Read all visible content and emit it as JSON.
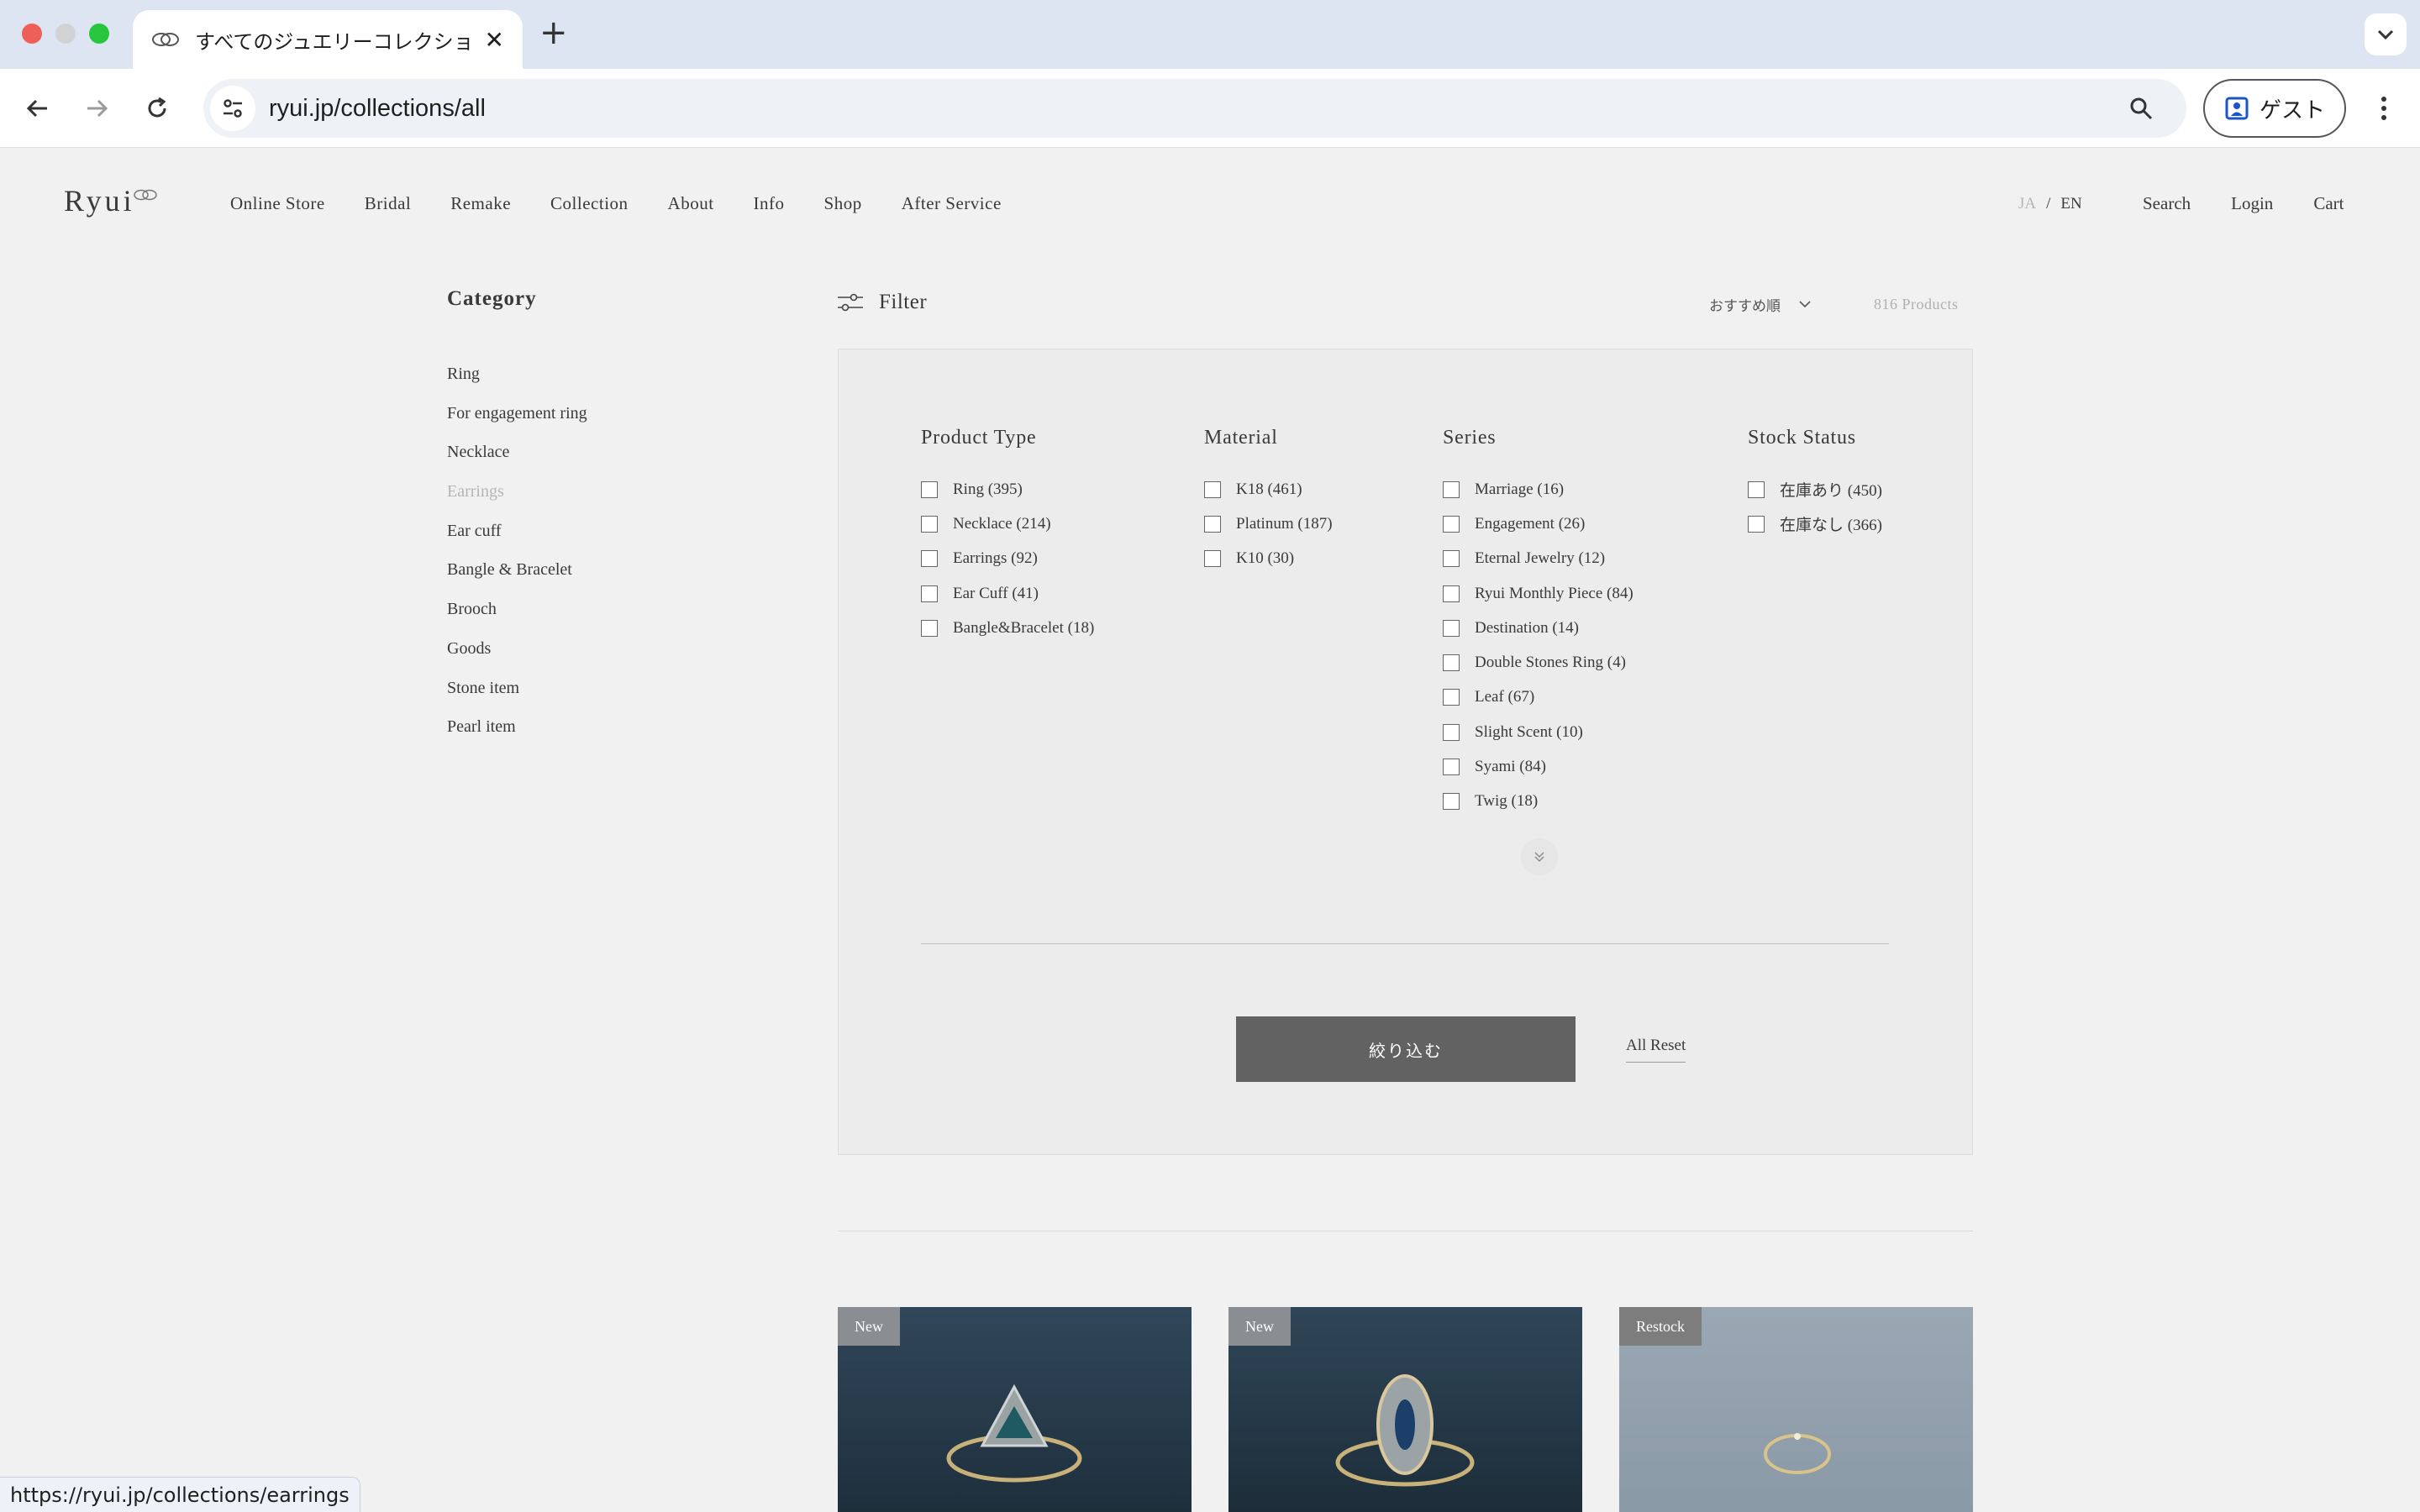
{
  "browser": {
    "tab_title": "すべてのジュエリーコレクション",
    "new_tab_label": "+",
    "tab_close_label": "✕",
    "url": "ryui.jp/collections/all",
    "profile_label": "ゲスト",
    "status_url": "https://ryui.jp/collections/earrings"
  },
  "site": {
    "logo": "Ryui",
    "nav": [
      "Online Store",
      "Bridal",
      "Remake",
      "Collection",
      "About",
      "Info",
      "Shop",
      "After Service"
    ],
    "lang": {
      "ja": "JA",
      "separator": "/",
      "en": "EN"
    },
    "util_nav": [
      "Search",
      "Login",
      "Cart"
    ]
  },
  "sidebar": {
    "title": "Category",
    "items": [
      {
        "label": "Ring"
      },
      {
        "label": "For engagement ring"
      },
      {
        "label": "Necklace"
      },
      {
        "label": "Earrings",
        "active": true
      },
      {
        "label": "Ear cuff"
      },
      {
        "label": "Bangle & Bracelet"
      },
      {
        "label": "Brooch"
      },
      {
        "label": "Goods"
      },
      {
        "label": "Stone item"
      },
      {
        "label": "Pearl item"
      }
    ]
  },
  "filter_bar": {
    "label": "Filter",
    "sort_label": "おすすめ順",
    "product_count": "816 Products"
  },
  "filters": {
    "product_type": {
      "title": "Product Type",
      "options": [
        "Ring (395)",
        "Necklace (214)",
        "Earrings (92)",
        "Ear Cuff (41)",
        "Bangle&Bracelet (18)"
      ]
    },
    "material": {
      "title": "Material",
      "options": [
        "K18 (461)",
        "Platinum (187)",
        "K10 (30)"
      ]
    },
    "series": {
      "title": "Series",
      "options": [
        "Marriage (16)",
        "Engagement (26)",
        "Eternal Jewelry (12)",
        "Ryui Monthly Piece (84)",
        "Destination (14)",
        "Double Stones Ring (4)",
        "Leaf (67)",
        "Slight Scent (10)",
        "Syami (84)",
        "Twig (18)"
      ]
    },
    "stock_status": {
      "title": "Stock Status",
      "options": [
        "在庫あり (450)",
        "在庫なし (366)"
      ]
    },
    "apply_label": "絞り込む",
    "reset_label": "All Reset"
  },
  "products": [
    {
      "badge": "New"
    },
    {
      "badge": "New"
    },
    {
      "badge": "Restock"
    }
  ],
  "colors": {
    "page_bg": "#f1f1f1",
    "panel_bg": "#ececec",
    "apply_button": "#626262",
    "tab_strip": "#dde5f3"
  }
}
